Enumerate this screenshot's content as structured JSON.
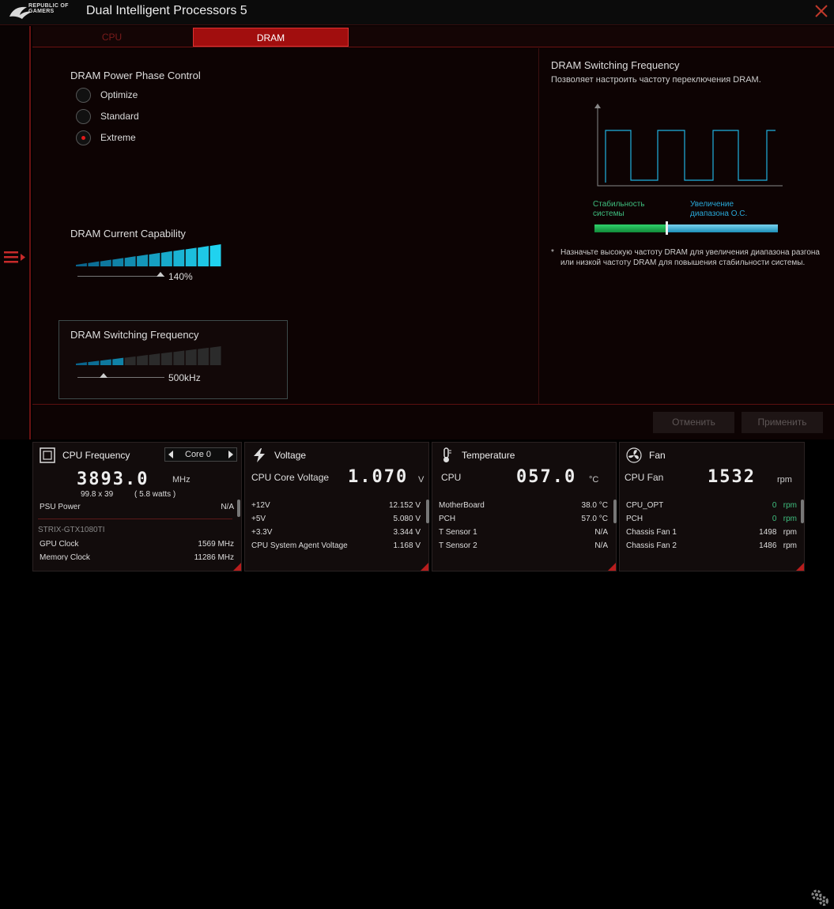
{
  "app": {
    "title": "Dual Intelligent Processors 5",
    "logo_line1": "REPUBLIC OF",
    "logo_line2": "GAMERS"
  },
  "tabs": [
    {
      "label": "CPU"
    },
    {
      "label": "DRAM"
    }
  ],
  "phase": {
    "title": "DRAM Power Phase Control",
    "options": [
      "Optimize",
      "Standard",
      "Extreme"
    ],
    "selected": "Extreme"
  },
  "current": {
    "title": "DRAM Current Capability",
    "value": "140%",
    "level": 1.0
  },
  "switching": {
    "title": "DRAM Switching Frequency",
    "value": "500kHz",
    "level": 0.33
  },
  "info": {
    "title": "DRAM Switching Frequency",
    "desc": "Позволяет настроить частоту переключения DRAM.",
    "stab": "Стабильность системы",
    "range": "Увеличение диапазона О.С.",
    "note": "Назначьте высокую частоту DRAM для увеличения  диапазона разгона или низкой частоту DRAM для повышения стабильности системы."
  },
  "buttons": {
    "cancel": "Отменить",
    "apply": "Применить"
  },
  "cpu_freq": {
    "title": "CPU Frequency",
    "core": "Core 0",
    "value": "3893.0",
    "unit": "MHz",
    "multiplier": "99.8  x  39",
    "watts": "( 5.8   watts )",
    "rows": [
      {
        "k": "PSU Power",
        "v": "N/A"
      }
    ],
    "gpu_name": "STRIX-GTX1080TI",
    "gpu_rows": [
      {
        "k": "GPU Clock",
        "v": "1569 MHz"
      },
      {
        "k": "Memory Clock",
        "v": "11286 MHz"
      }
    ]
  },
  "voltage": {
    "title": "Voltage",
    "label": "CPU Core Voltage",
    "value": "1.070",
    "unit": "V",
    "rows": [
      {
        "k": "+12V",
        "v": "12.152  V"
      },
      {
        "k": "+5V",
        "v": "5.080  V"
      },
      {
        "k": "+3.3V",
        "v": "3.344  V"
      },
      {
        "k": "CPU System Agent Voltage",
        "v": "1.168  V"
      }
    ]
  },
  "temperature": {
    "title": "Temperature",
    "label": "CPU",
    "value": "057.0",
    "unit": "°C",
    "rows": [
      {
        "k": "MotherBoard",
        "v": "38.0 °C"
      },
      {
        "k": "PCH",
        "v": "57.0 °C"
      },
      {
        "k": "T Sensor 1",
        "v": "N/A"
      },
      {
        "k": "T Sensor 2",
        "v": "N/A"
      }
    ]
  },
  "fan": {
    "title": "Fan",
    "label": "CPU Fan",
    "value": "1532",
    "unit": "rpm",
    "rows": [
      {
        "k": "CPU_OPT",
        "v": "0",
        "u": "rpm"
      },
      {
        "k": "PCH",
        "v": "0",
        "u": "rpm"
      },
      {
        "k": "Chassis Fan 1",
        "v": "1498",
        "u": "rpm"
      },
      {
        "k": "Chassis Fan 2",
        "v": "1486",
        "u": "rpm"
      }
    ]
  },
  "colors": {
    "accent": "#a10e0e",
    "cyan": "#1fb1e0",
    "green": "#1fa552"
  }
}
